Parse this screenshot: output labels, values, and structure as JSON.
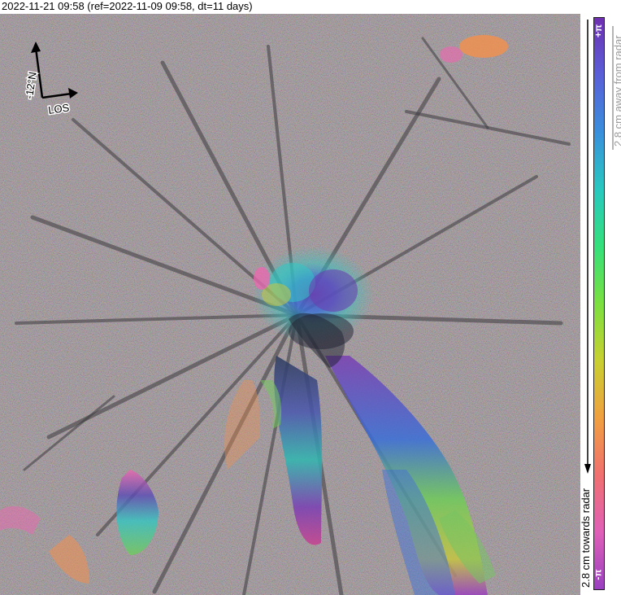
{
  "header": {
    "title": "2022-11-21 09:58 (ref=2022-11-09 09:58, dt=11 days)"
  },
  "orientation": {
    "north_label": "-12°N",
    "los_label": "LOS"
  },
  "colorbar": {
    "top_label": "+π",
    "bottom_label": "-π",
    "away_label": "2.8 cm away from radar",
    "towards_label": "2.8 cm towards radar",
    "colors": [
      "#6e2fb0",
      "#5a5fd8",
      "#3a8fdc",
      "#28c8c0",
      "#34e07c",
      "#7be040",
      "#c8d030",
      "#f0a040",
      "#f07070",
      "#e060b8",
      "#9a40c0"
    ]
  },
  "map": {
    "summary_colors": {
      "background": "#8a7f86",
      "ridge_shadow": "#3c3a3e",
      "fringe_blue": "#3a6fd8",
      "fringe_purple": "#7a3fb4",
      "fringe_cyan": "#33c6c2",
      "fringe_green": "#5fd870",
      "fringe_yellow": "#c6c640",
      "fringe_orange": "#f09050",
      "fringe_pink": "#f066b0"
    }
  }
}
